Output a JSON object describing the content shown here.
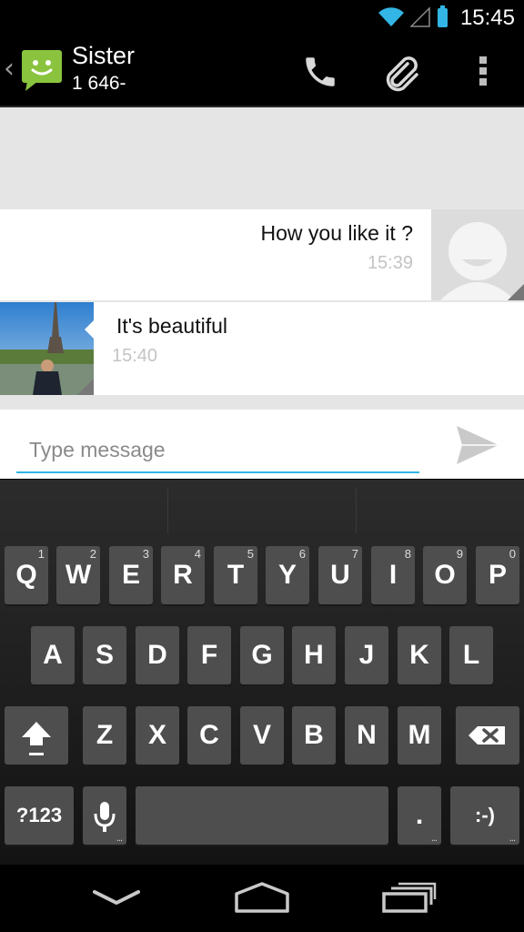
{
  "status_bar": {
    "time": "15:45",
    "battery_color": "#33b5e5",
    "wifi_color": "#33b5e5"
  },
  "action_bar": {
    "contact_name": "Sister",
    "contact_number": "1 646-",
    "icons": [
      "back-chevron-icon",
      "messaging-app-icon",
      "phone-icon",
      "attach-icon",
      "overflow-menu-icon"
    ]
  },
  "conversation": {
    "messages": [
      {
        "direction": "outgoing",
        "text": "How you like it ?",
        "time": "15:39",
        "avatar": "default-avatar"
      },
      {
        "direction": "incoming",
        "text": "It's beautiful",
        "time": "15:40",
        "avatar": "contact-photo"
      }
    ]
  },
  "compose": {
    "placeholder": "Type message",
    "value": "",
    "accent_color": "#33b5e5"
  },
  "keyboard": {
    "row1": [
      {
        "label": "Q",
        "num": "1"
      },
      {
        "label": "W",
        "num": "2"
      },
      {
        "label": "E",
        "num": "3"
      },
      {
        "label": "R",
        "num": "4"
      },
      {
        "label": "T",
        "num": "5"
      },
      {
        "label": "Y",
        "num": "6"
      },
      {
        "label": "U",
        "num": "7"
      },
      {
        "label": "I",
        "num": "8"
      },
      {
        "label": "O",
        "num": "9"
      },
      {
        "label": "P",
        "num": "0"
      }
    ],
    "row2": [
      "A",
      "S",
      "D",
      "F",
      "G",
      "H",
      "J",
      "K",
      "L"
    ],
    "row3": [
      "Z",
      "X",
      "C",
      "V",
      "B",
      "N",
      "M"
    ],
    "symbols_key": "?123",
    "period_key": ".",
    "emoticon_key": ":-)",
    "more_dots": "..."
  },
  "nav_bar": {
    "icons": [
      "back-icon",
      "home-icon",
      "recent-apps-icon"
    ]
  }
}
